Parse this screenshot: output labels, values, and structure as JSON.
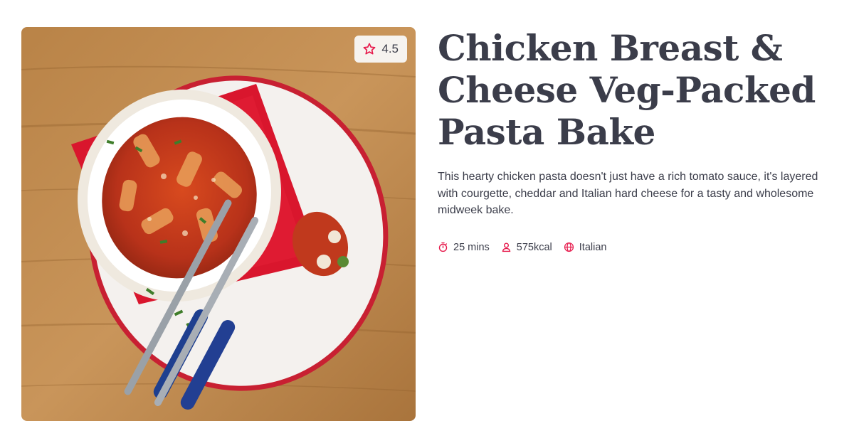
{
  "recipe": {
    "title": "Chicken Breast & Cheese Veg-Packed Pasta Bake",
    "description": "This hearty chicken pasta doesn't just have a rich tomato sauce, it's layered with courgette, cheddar and Italian hard cheese for a tasty and wholesome midweek bake.",
    "rating": "4.5",
    "image_alt": "Chicken breast and cheese pasta bake on a plate"
  },
  "meta": {
    "time": "25 mins",
    "calories": "575kcal",
    "cuisine": "Italian"
  },
  "icons": {
    "rating": "star-icon",
    "time": "timer-icon",
    "calories": "person-icon",
    "cuisine": "globe-icon"
  },
  "colors": {
    "accent": "#e6194b",
    "text": "#3b3d4a",
    "badge_bg": "#f6f3ef"
  }
}
